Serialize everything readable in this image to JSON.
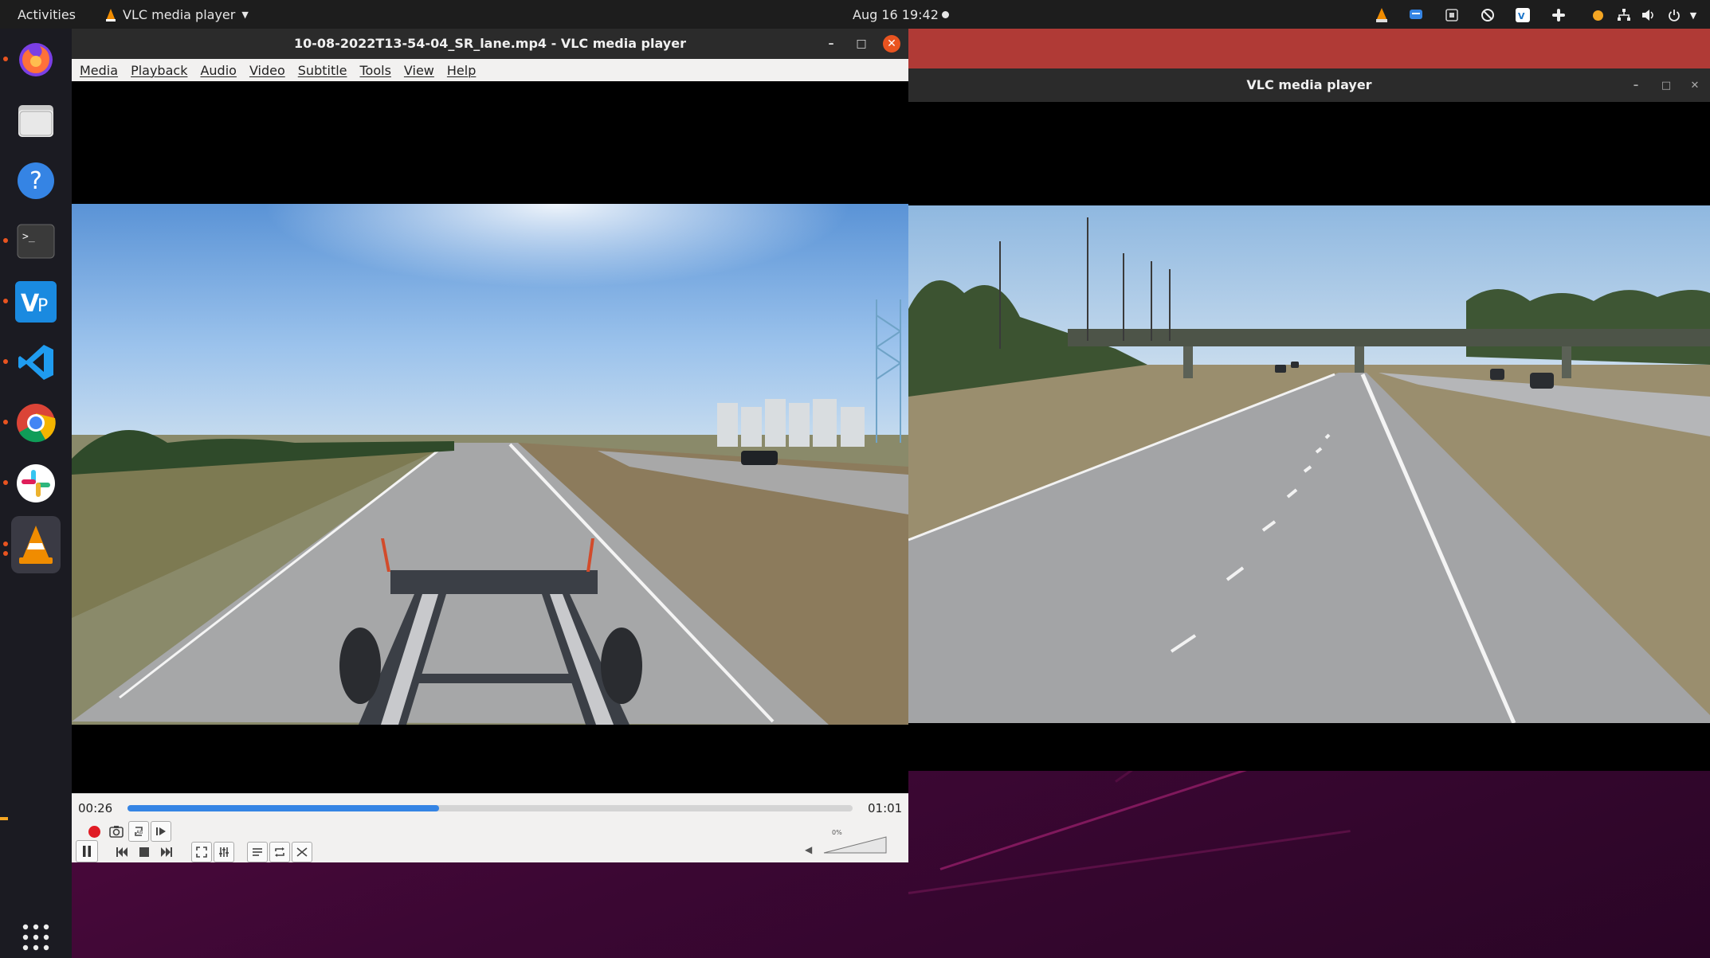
{
  "topbar": {
    "activities": "Activities",
    "app_menu": "VLC media player",
    "clock": "Aug 16  19:42"
  },
  "dock": {
    "items": [
      "firefox",
      "files",
      "help",
      "terminal",
      "visual-paradigm",
      "vscode",
      "chrome",
      "slack",
      "vlc"
    ],
    "grid_icon": "show-applications-icon"
  },
  "vlc_main": {
    "title": "10-08-2022T13-54-04_SR_lane.mp4 - VLC media player",
    "menu": [
      "Media",
      "Playback",
      "Audio",
      "Video",
      "Subtitle",
      "Tools",
      "View",
      "Help"
    ],
    "elapsed": "00:26",
    "duration": "01:01",
    "progress": 0.43,
    "volume_label": "0%",
    "volume": 0.0
  },
  "vlc_second": {
    "title": "VLC media player"
  },
  "colors": {
    "accent": "#e95420",
    "seek": "#3584e4",
    "record": "#e01b24"
  }
}
